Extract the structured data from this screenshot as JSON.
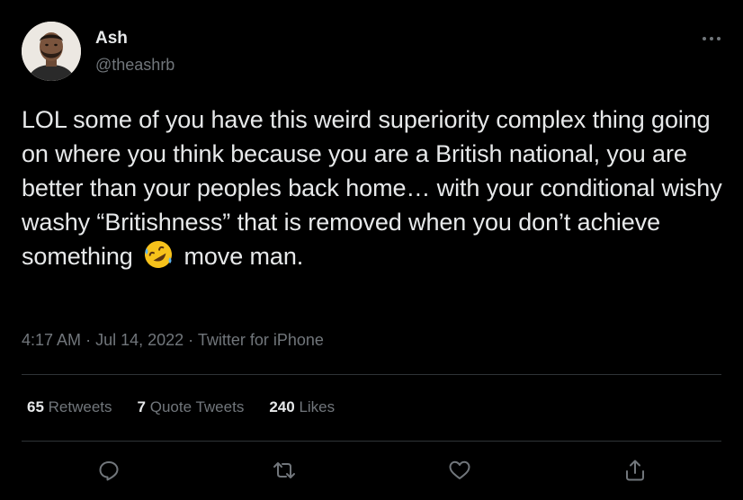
{
  "user": {
    "name": "Ash",
    "handle": "@theashrb"
  },
  "tweet": {
    "text_before_emoji": "LOL some of you have this weird superiority complex thing going on where you think because you are a British national, you are better than your peoples back home… with your conditional wishy washy “Britishness” that is removed when you don’t achieve something",
    "emoji": "rolling-on-floor-laughing",
    "text_after_emoji": "move man.",
    "time": "4:17 AM",
    "separator": "·",
    "date": "Jul 14, 2022",
    "source": "Twitter for iPhone"
  },
  "stats": {
    "retweets_count": "65",
    "retweets_label": "Retweets",
    "quotes_count": "7",
    "quotes_label": "Quote Tweets",
    "likes_count": "240",
    "likes_label": "Likes"
  },
  "icons": {
    "more": "more-horizontal-icon",
    "reply": "reply-icon",
    "retweet": "retweet-icon",
    "like": "heart-icon",
    "share": "share-icon"
  },
  "colors": {
    "background": "#000000",
    "text": "#e7e9ea",
    "secondary": "#71767b",
    "divider": "#2f3336"
  }
}
